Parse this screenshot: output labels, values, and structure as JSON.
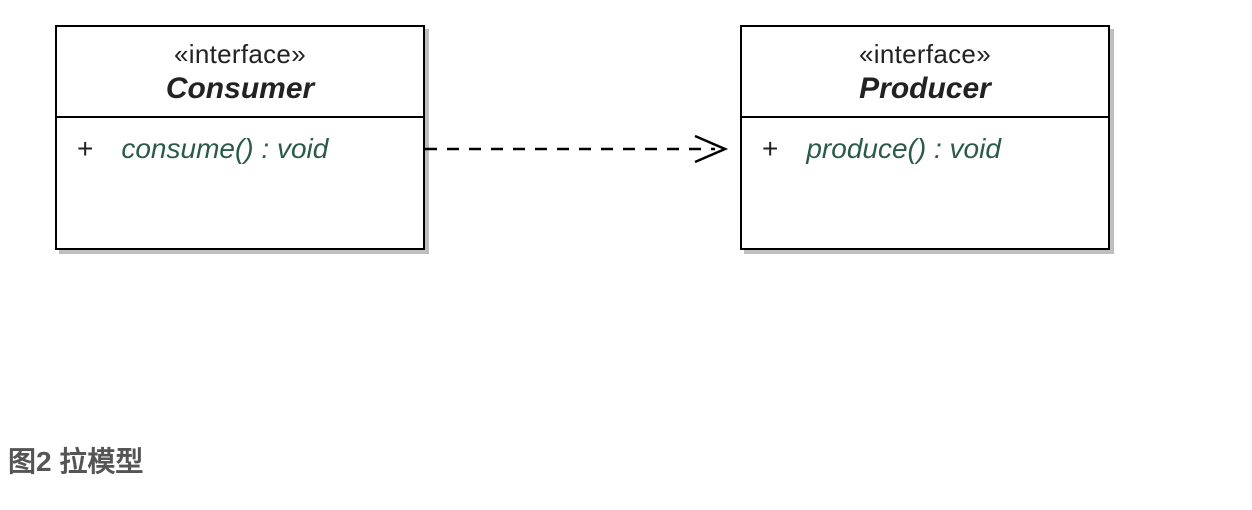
{
  "diagram": {
    "left_box": {
      "stereotype": "«interface»",
      "name": "Consumer",
      "visibility": "+",
      "method": "consume() : void"
    },
    "right_box": {
      "stereotype": "«interface»",
      "name": "Producer",
      "visibility": "+",
      "method": "produce() : void"
    },
    "relationship": {
      "type": "dependency",
      "direction": "left-to-right"
    }
  },
  "caption": {
    "label": "图2",
    "text": "拉模型"
  }
}
